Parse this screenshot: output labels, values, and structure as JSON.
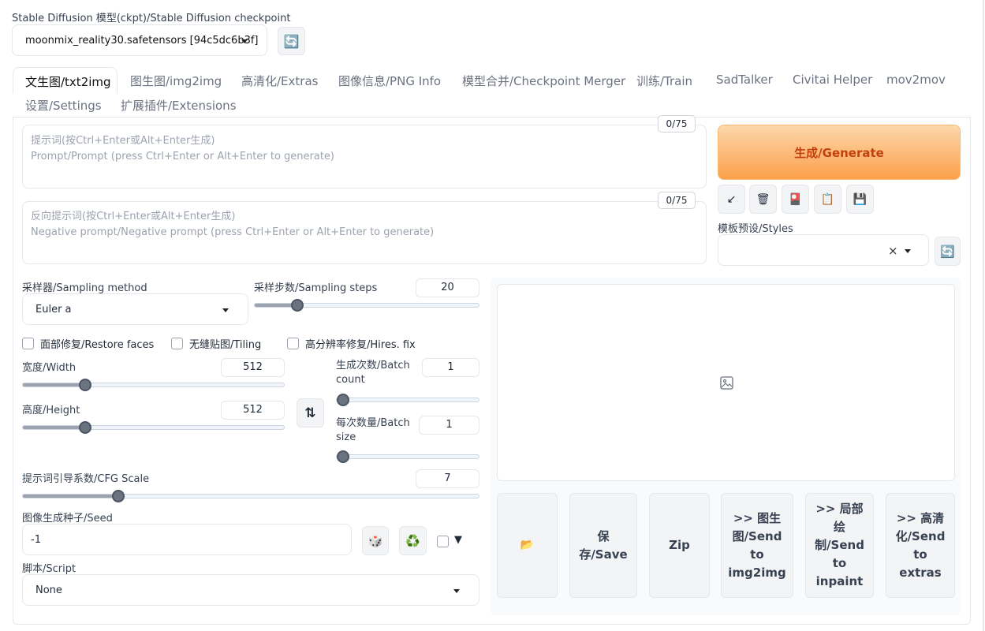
{
  "checkpoint": {
    "label": "Stable Diffusion 模型(ckpt)/Stable Diffusion checkpoint",
    "value": "moonmix_reality30.safetensors [94c5dc6b3f]"
  },
  "tabs": [
    "文生图/txt2img",
    "图生图/img2img",
    "高清化/Extras",
    "图像信息/PNG Info",
    "模型合并/Checkpoint Merger",
    "训练/Train",
    "SadTalker",
    "Civitai Helper",
    "mov2mov",
    "设置/Settings",
    "扩展插件/Extensions"
  ],
  "prompt": {
    "counter": "0/75",
    "placeholder_line1": "提示词(按Ctrl+Enter或Alt+Enter生成)",
    "placeholder_line2": "Prompt/Prompt (press Ctrl+Enter or Alt+Enter to generate)"
  },
  "negative_prompt": {
    "counter": "0/75",
    "placeholder_line1": "反向提示词(按Ctrl+Enter或Alt+Enter生成)",
    "placeholder_line2": "Negative prompt/Negative prompt (press Ctrl+Enter or Alt+Enter to generate)"
  },
  "generate": {
    "label": "生成/Generate"
  },
  "styles": {
    "label": "模板预设/Styles",
    "clear": "×"
  },
  "sampler": {
    "label": "采样器/Sampling method",
    "value": "Euler a"
  },
  "steps": {
    "label": "采样步数/Sampling steps",
    "value": "20",
    "fraction": 0.19
  },
  "checkboxes": {
    "restore_faces": "面部修复/Restore faces",
    "tiling": "无缝贴图/Tiling",
    "hires_fix": "高分辨率修复/Hires. fix"
  },
  "width": {
    "label": "宽度/Width",
    "value": "512",
    "fraction": 0.24
  },
  "height": {
    "label": "高度/Height",
    "value": "512",
    "fraction": 0.24
  },
  "batch_count": {
    "label_line1": "生成次数/Batch",
    "label_line2": "count",
    "value": "1",
    "fraction": 0.0
  },
  "batch_size": {
    "label_line1": "每次数量/Batch",
    "label_line2": "size",
    "value": "1",
    "fraction": 0.0
  },
  "cfg": {
    "label": "提示词引导系数/CFG Scale",
    "value": "7",
    "fraction": 0.21
  },
  "seed": {
    "label": "图像生成种子/Seed",
    "value": "-1",
    "extra_caret": "▼"
  },
  "script": {
    "label": "脚本/Script",
    "value": "None"
  },
  "tool_icons": {
    "read": "↙",
    "trash": "🗑",
    "card": "🎴",
    "clipboard": "📋",
    "save": "💾",
    "refresh": "🔄",
    "dice": "🎲",
    "recycle": "♻️",
    "swap": "⇅",
    "folder": "📂"
  },
  "output_buttons": {
    "save": "保\n存/Save",
    "zip": "Zip",
    "send_img2img": ">> 图生\n图/Send\nto\nimg2img",
    "send_inpaint": ">> 局部\n绘\n制/Send\nto\ninpaint",
    "send_extras": ">> 高清\n化/Send\nto\nextras"
  }
}
